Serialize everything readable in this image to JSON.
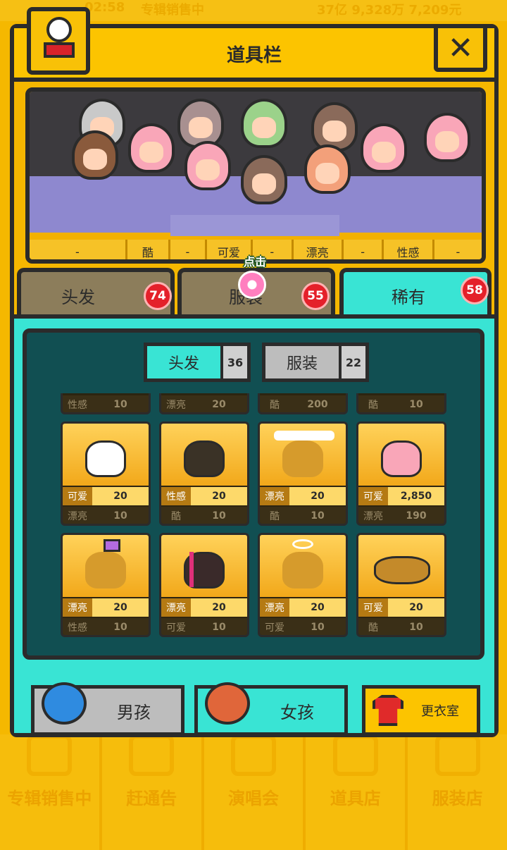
{
  "background": {
    "top_text": [
      "02:58",
      "专辑销售中",
      "37亿 9,328万 7,209元"
    ],
    "nav": [
      {
        "label": "专辑销售中",
        "icon": "cd-icon"
      },
      {
        "label": "赶通告",
        "icon": "schedule-icon"
      },
      {
        "label": "演唱会",
        "icon": "concert-icon"
      },
      {
        "label": "道具店",
        "icon": "shop-icon"
      },
      {
        "label": "服装店",
        "icon": "clothes-icon"
      }
    ]
  },
  "header": {
    "title": "道具栏",
    "close_label": "✕"
  },
  "stage": {
    "attributes": [
      "-",
      "酷",
      "-",
      "可爱",
      "-",
      "漂亮",
      "-",
      "性感",
      "-"
    ]
  },
  "hint": {
    "text": "点击"
  },
  "tabs": [
    {
      "label": "头发",
      "count": "74"
    },
    {
      "label": "服装",
      "count": "55"
    },
    {
      "label": "稀有",
      "count": "58"
    }
  ],
  "subtabs": [
    {
      "label": "头发",
      "count": "36"
    },
    {
      "label": "服装",
      "count": "22"
    }
  ],
  "partial_row": [
    {
      "k2": "性感",
      "v2": "10"
    },
    {
      "k2": "漂亮",
      "v2": "20"
    },
    {
      "k2": "酷",
      "v2": "200"
    },
    {
      "k2": "酷",
      "v2": "10"
    }
  ],
  "items": [
    {
      "k1": "可爱",
      "v1": "20",
      "k2": "漂亮",
      "v2": "10",
      "new": false
    },
    {
      "k1": "性感",
      "v1": "20",
      "k2": "酷",
      "v2": "10",
      "new": false
    },
    {
      "k1": "漂亮",
      "v1": "20",
      "k2": "酷",
      "v2": "10",
      "new": true
    },
    {
      "k1": "可爱",
      "v1": "2,850",
      "k2": "漂亮",
      "v2": "190",
      "new": true
    },
    {
      "k1": "漂亮",
      "v1": "20",
      "k2": "性感",
      "v2": "10",
      "new": false
    },
    {
      "k1": "漂亮",
      "v1": "20",
      "k2": "可爱",
      "v2": "10",
      "new": false
    },
    {
      "k1": "漂亮",
      "v1": "20",
      "k2": "可爱",
      "v2": "10",
      "new": true
    },
    {
      "k1": "可爱",
      "v1": "20",
      "k2": "酷",
      "v2": "10",
      "new": false
    }
  ],
  "bottom": {
    "boy": "男孩",
    "girl": "女孩",
    "dressing_room": "更衣室"
  },
  "colors": {
    "accent": "#39e4d4",
    "panel": "#f5b700",
    "badge": "#e4202a",
    "dark": "#114f52"
  }
}
